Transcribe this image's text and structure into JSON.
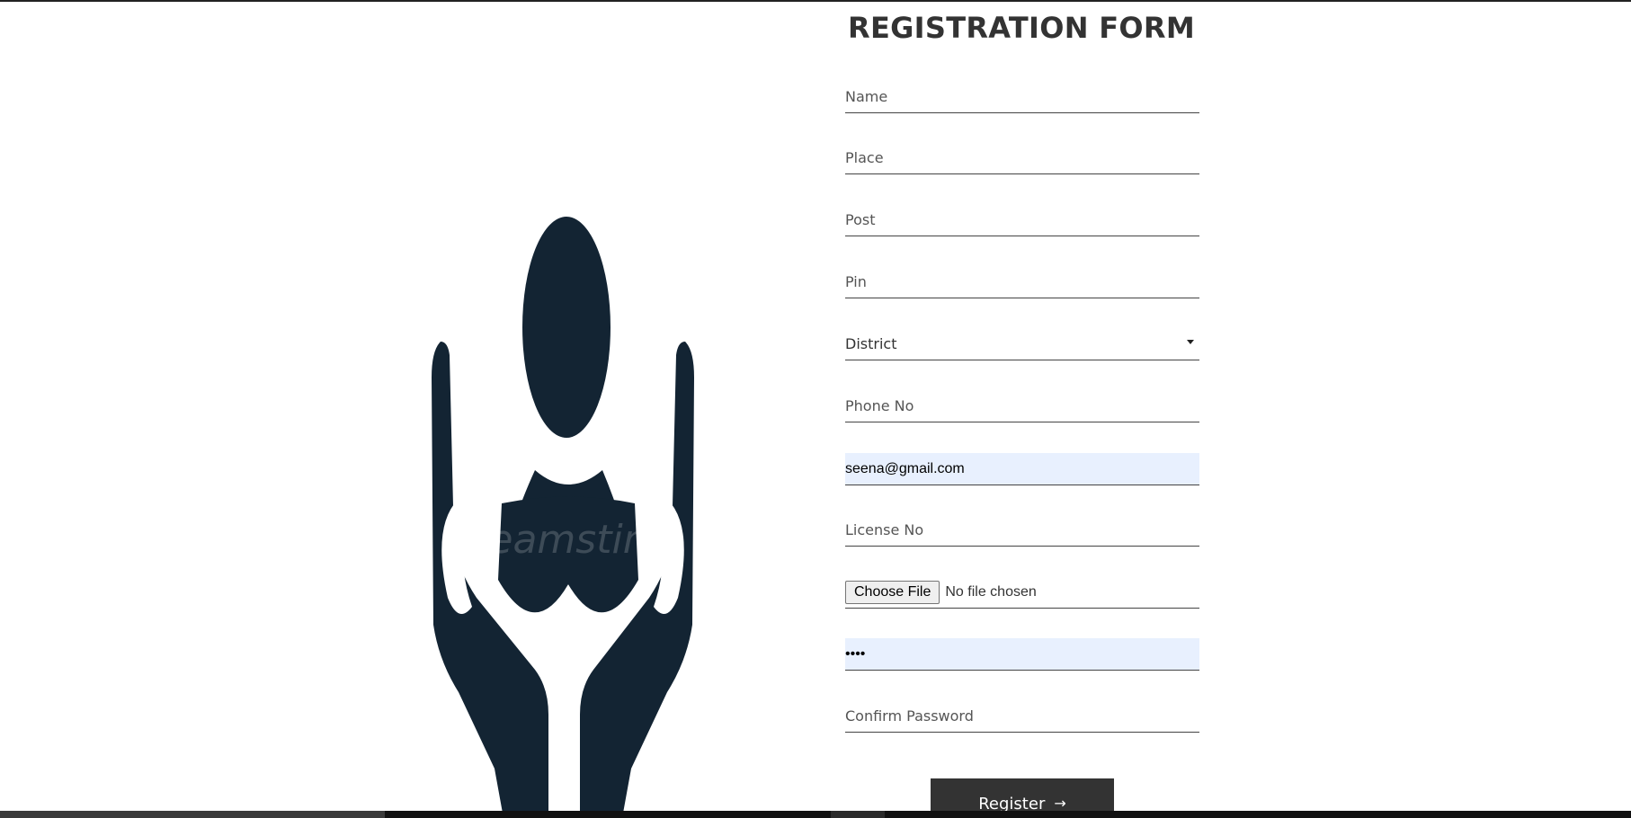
{
  "form": {
    "title": "REGISTRATION FORM",
    "name_placeholder": "Name",
    "place_placeholder": "Place",
    "post_placeholder": "Post",
    "pin_placeholder": "Pin",
    "district_selected": "District",
    "phone_placeholder": "Phone No",
    "email_value": "seena@gmail.com",
    "license_placeholder": "License No",
    "choose_file_label": "Choose File",
    "file_status": "No file chosen",
    "password_value": "••••",
    "confirm_password_placeholder": "Confirm Password",
    "register_label": "Register",
    "register_arrow": "→"
  },
  "illustration": {
    "icon": "person-in-hands-icon",
    "watermark": "dreamstime",
    "color": "#132433"
  },
  "colors": {
    "autofill_background": "#e8f0fe",
    "button_background": "#333333",
    "title_color": "#333333"
  }
}
